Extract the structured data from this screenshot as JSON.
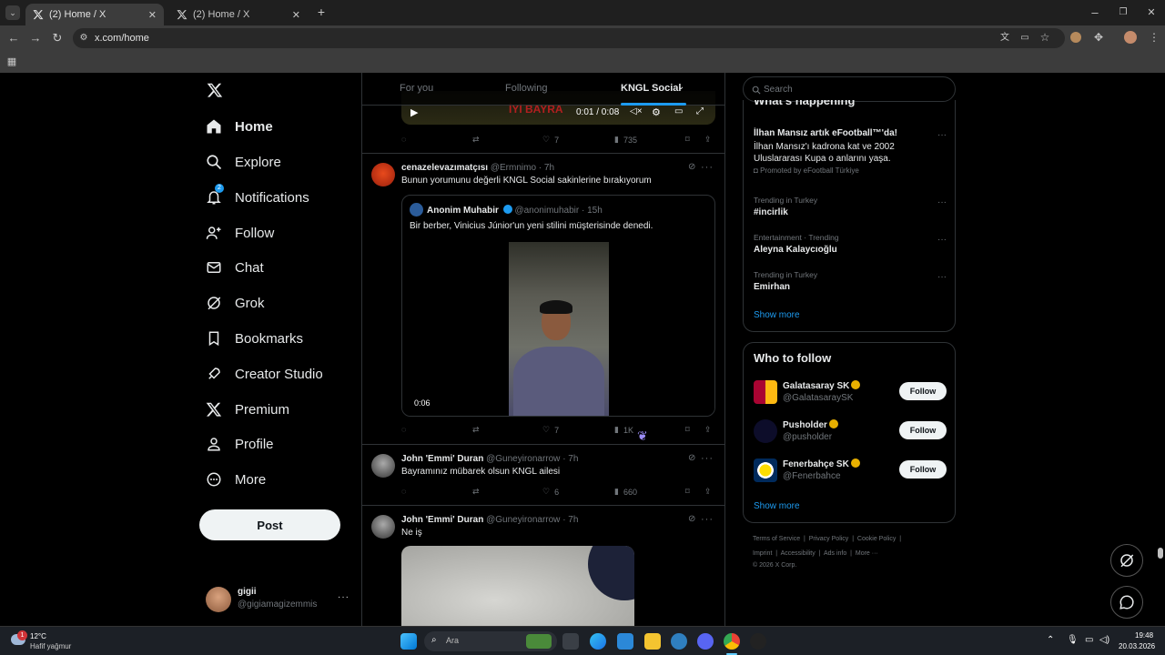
{
  "browser": {
    "tabs": [
      {
        "title": "(2) Home / X",
        "active": true
      },
      {
        "title": "(2) Home / X",
        "active": false
      }
    ],
    "url": "x.com/home"
  },
  "nav": {
    "items": [
      {
        "label": "Home",
        "icon": "home-icon"
      },
      {
        "label": "Explore",
        "icon": "search-icon"
      },
      {
        "label": "Notifications",
        "icon": "bell-icon",
        "badge": "2"
      },
      {
        "label": "Follow",
        "icon": "person-add-icon"
      },
      {
        "label": "Chat",
        "icon": "mail-icon"
      },
      {
        "label": "Grok",
        "icon": "grok-icon"
      },
      {
        "label": "Bookmarks",
        "icon": "bookmark-icon"
      },
      {
        "label": "Creator Studio",
        "icon": "rocket-icon"
      },
      {
        "label": "Premium",
        "icon": "x-icon"
      },
      {
        "label": "Profile",
        "icon": "person-icon"
      },
      {
        "label": "More",
        "icon": "more-circle-icon"
      }
    ],
    "post_label": "Post",
    "account": {
      "name": "gigii",
      "handle": "@gigiamagizemmis"
    }
  },
  "timeline": {
    "tabs": [
      "For you",
      "Following",
      "KNGL Social"
    ],
    "video_overlay": {
      "time": "0:01 / 0:08",
      "banner_text": "İYİ BAYRA"
    },
    "post0_actions": {
      "likes": "7",
      "views": "735"
    },
    "posts": [
      {
        "name": "cenazelevazımatçısı",
        "handle": "@Ermnimo",
        "time": "· 7h",
        "text": "Bunun yorumunu değerli KNGL Social sakinlerine bırakıyorum",
        "quote": {
          "name": "Anonim Muhabir",
          "handle": "@anonimuhabir",
          "time": "· 15h",
          "text": "Bir berber, Vinicius Júnior'un yeni stilini müşterisinde denedi.",
          "video_duration": "0:06"
        },
        "likes": "7",
        "views": "1K"
      },
      {
        "name": "John 'Emmi' Duran",
        "handle": "@Guneyironarrow",
        "time": "· 7h",
        "text": "Bayramınız mübarek olsun KNGL ailesi",
        "likes": "6",
        "views": "660"
      },
      {
        "name": "John 'Emmi' Duran",
        "handle": "@Guneyironarrow",
        "time": "· 7h",
        "text": "Ne iş"
      }
    ]
  },
  "sidebar": {
    "search_placeholder": "Search",
    "whats_happening": {
      "title": "What's happening",
      "promo": {
        "title": "İlhan Mansız artık eFootball™'da!",
        "desc": "İlhan Mansız'ı kadrona kat ve 2002 Uluslararası Kupa o anlarını yaşa.",
        "promoted": "Promoted by eFootball Türkiye"
      },
      "trends": [
        {
          "meta": "Trending in Turkey",
          "name": "#incirlik"
        },
        {
          "meta": "Entertainment · Trending",
          "name": "Aleyna Kalaycıoğlu"
        },
        {
          "meta": "Trending in Turkey",
          "name": "Emirhan"
        }
      ],
      "show_more": "Show more"
    },
    "who_to_follow": {
      "title": "Who to follow",
      "accounts": [
        {
          "name": "Galatasaray SK",
          "handle": "@GalatasaraySK",
          "button": "Follow"
        },
        {
          "name": "Pusholder",
          "handle": "@pusholder",
          "button": "Follow"
        },
        {
          "name": "Fenerbahçe SK",
          "handle": "@Fenerbahce",
          "button": "Follow"
        }
      ],
      "show_more": "Show more"
    },
    "footer": {
      "line1": [
        "Terms of Service",
        "Privacy Policy",
        "Cookie Policy"
      ],
      "line2": [
        "Imprint",
        "Accessibility",
        "Ads info",
        "More ···"
      ],
      "copyright": "© 2026 X Corp."
    }
  },
  "taskbar": {
    "weather_temp": "12°C",
    "weather_desc": "Hafif yağmur",
    "weather_badge": "1",
    "search_placeholder": "Ara",
    "time": "19:48",
    "date": "20.03.2026"
  },
  "colors": {
    "accent": "#1d9bf0",
    "background": "#000000",
    "border": "#2f3336",
    "muted": "#71767b"
  }
}
